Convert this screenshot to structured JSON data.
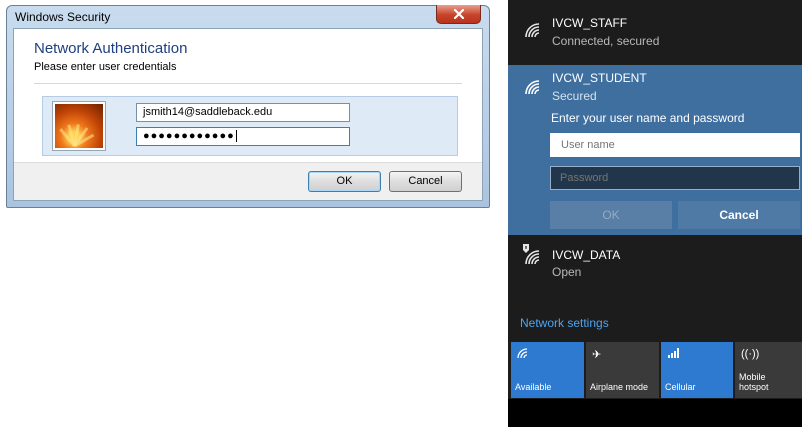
{
  "win7_dialog": {
    "title": "Windows Security",
    "heading": "Network Authentication",
    "subheading": "Please enter user credentials",
    "username_value": "jsmith14@saddleback.edu",
    "password_mask": "●●●●●●●●●●●●",
    "ok_label": "OK",
    "cancel_label": "Cancel"
  },
  "win10_flyout": {
    "networks": [
      {
        "name": "IVCW_STAFF",
        "status": "Connected, secured"
      },
      {
        "name": "IVCW_STUDENT",
        "status": "Secured"
      },
      {
        "name": "IVCW_DATA",
        "status": "Open"
      }
    ],
    "prompt": "Enter your user name and password",
    "username_placeholder": "User name",
    "password_placeholder": "Password",
    "ok_label": "OK",
    "cancel_label": "Cancel",
    "settings_link": "Network settings",
    "quick_actions": [
      {
        "label": "Available",
        "icon": "wifi-icon",
        "active": true
      },
      {
        "label": "Airplane mode",
        "icon": "airplane-icon",
        "active": false
      },
      {
        "label": "Cellular",
        "icon": "cellular-icon",
        "active": true
      },
      {
        "label": "Mobile hotspot",
        "icon": "hotspot-icon",
        "active": false
      }
    ],
    "colors": {
      "accent": "#2f7ad1",
      "selected_network_bg": "#3f6f9f",
      "link": "#4ea4f0"
    }
  }
}
